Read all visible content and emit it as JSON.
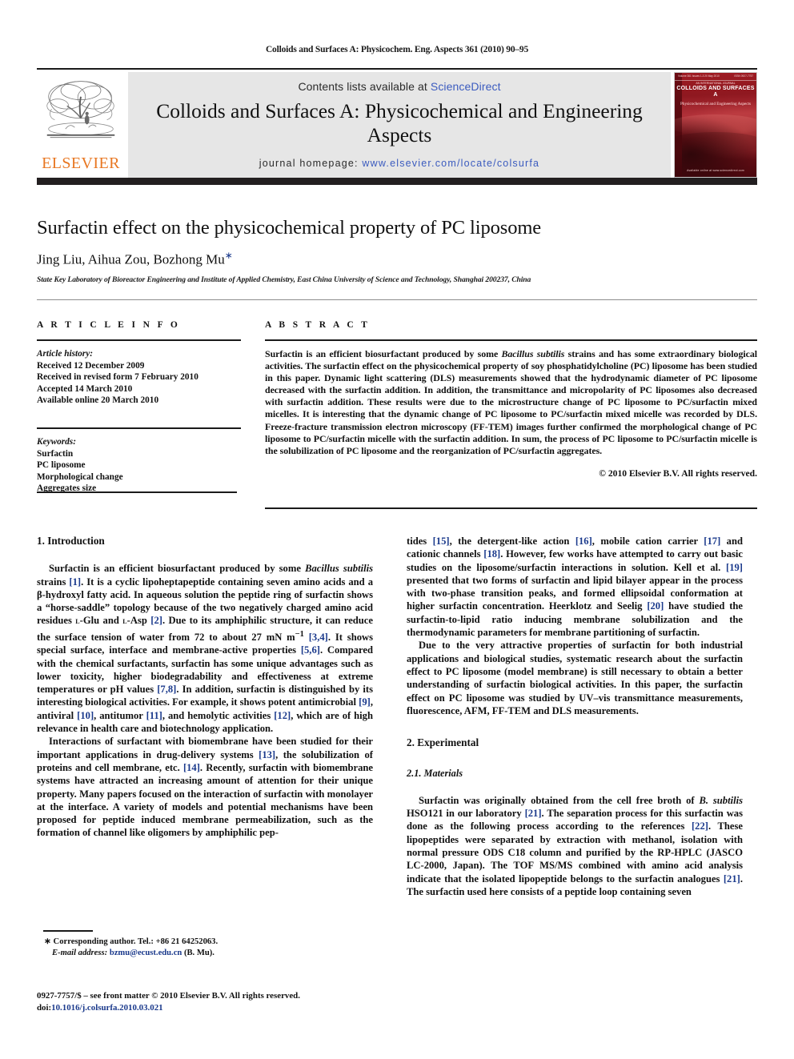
{
  "running_head": "Colloids and Surfaces A: Physicochem. Eng. Aspects 361 (2010) 90–95",
  "masthead": {
    "publisher_name": "ELSEVIER",
    "contents_prefix": "Contents lists available at ",
    "contents_link": "ScienceDirect",
    "journal_title": "Colloids and Surfaces A: Physicochemical and Engineering Aspects",
    "homepage_prefix": "journal homepage:",
    "homepage_url": "www.elsevier.com/locate/colsurfa",
    "cover": {
      "volume_line_left": "Volume 361 Issues 1-3 20 May 2010",
      "volume_line_right": "ISSN 0927-7757",
      "eyebrow": "AN INTERNATIONAL JOURNAL",
      "title": "COLLOIDS AND SURFACES A",
      "subtitle": "Physicochemical and Engineering Aspects",
      "footer": "Available online at www.sciencedirect.com"
    }
  },
  "article": {
    "title": "Surfactin effect on the physicochemical property of PC liposome",
    "authors": "Jing Liu, Aihua Zou, Bozhong Mu",
    "corresponding_marker": "∗",
    "affiliation": "State Key Laboratory of Bioreactor Engineering and Institute of Applied Chemistry, East China University of Science and Technology, Shanghai 200237, China"
  },
  "article_info": {
    "section_label": "A R T I C L E    I N F O",
    "history_label": "Article history:",
    "history": [
      "Received 12 December 2009",
      "Received in revised form 7 February 2010",
      "Accepted 14 March 2010",
      "Available online 20 March 2010"
    ],
    "keywords_label": "Keywords:",
    "keywords": [
      "Surfactin",
      "PC liposome",
      "Morphological change",
      "Aggregates size"
    ]
  },
  "abstract": {
    "section_label": "A B S T R A C T",
    "paragraph_1": "Surfactin is an efficient biosurfactant produced by some ",
    "italic_species": "Bacillus subtilis",
    "paragraph_2": " strains and has some extraordinary biological activities. The surfactin effect on the physicochemical property of soy phosphatidylcholine (PC) liposome has been studied in this paper. Dynamic light scattering (DLS) measurements showed that the hydrodynamic diameter of PC liposome decreased with the surfactin addition. In addition, the transmittance and micropolarity of PC liposomes also decreased with surfactin addition. These results were due to the microstructure change of PC liposome to PC/surfactin mixed micelles. It is interesting that the dynamic change of PC liposome to PC/surfactin mixed micelle was recorded by DLS. Freeze-fracture transmission electron microscopy (FF-TEM) images further confirmed the morphological change of PC liposome to PC/surfactin micelle with the surfactin addition. In sum, the process of PC liposome to PC/surfactin micelle is the solubilization of PC liposome and the reorganization of PC/surfactin aggregates.",
    "copyright": "© 2010 Elsevier B.V. All rights reserved."
  },
  "body": {
    "heading_introduction": "1.  Introduction",
    "heading_experimental": "2.  Experimental",
    "heading_materials": "2.1.  Materials",
    "left_p1_a": "Surfactin is an efficient biosurfactant produced by some ",
    "left_p1_italic1": "Bacillus subtilis",
    "left_p1_b": " strains ",
    "left_p1_ref1": "[1]",
    "left_p1_c": ". It is a cyclic lipoheptapeptide containing seven amino acids and a β-hydroxyl fatty acid. In aqueous solution the peptide ring of surfactin shows a “horse-saddle” topology because of the two negatively charged amino acid residues ",
    "left_p1_sc1": "l",
    "left_p1_d": "-Glu and ",
    "left_p1_sc2": "l",
    "left_p1_e": "-Asp ",
    "left_p1_ref2": "[2]",
    "left_p1_f": ". Due to its amphiphilic structure, it can reduce the surface tension of water from 72 to about 27 mN m",
    "left_p1_sup": "−1",
    "left_p1_g": " ",
    "left_p1_ref3": "[3,4]",
    "left_p1_h": ". It shows special surface, interface and membrane-active properties ",
    "left_p1_ref4": "[5,6]",
    "left_p1_i": ". Compared with the chemical surfactants, surfactin has some unique advantages such as lower toxicity, higher biodegradability and effectiveness at extreme temperatures or pH values ",
    "left_p1_ref5": "[7,8]",
    "left_p1_j": ". In addition, surfactin is distinguished by its interesting biological activities. For example, it shows potent antimicrobial ",
    "left_p1_ref6": "[9]",
    "left_p1_k": ", antiviral ",
    "left_p1_ref7": "[10]",
    "left_p1_l": ", antitumor ",
    "left_p1_ref8": "[11]",
    "left_p1_m": ", and hemolytic activities ",
    "left_p1_ref9": "[12]",
    "left_p1_n": ", which are of high relevance in health care and biotechnology application.",
    "left_p2_a": "Interactions of surfactant with biomembrane have been studied for their important applications in drug-delivery systems ",
    "left_p2_ref1": "[13]",
    "left_p2_b": ", the solubilization of proteins and cell membrane, etc. ",
    "left_p2_ref2": "[14]",
    "left_p2_c": ". Recently, surfactin with biomembrane systems have attracted an increasing amount of attention for their unique property. Many papers focused on the interaction of surfactin with monolayer at the interface. A variety of models and potential mechanisms have been proposed for peptide induced membrane permeabilization, such as the formation of channel like oligomers by amphiphilic pep-",
    "right_p1_a": "tides ",
    "right_p1_ref1": "[15]",
    "right_p1_b": ", the detergent-like action ",
    "right_p1_ref2": "[16]",
    "right_p1_c": ", mobile cation carrier ",
    "right_p1_ref3": "[17]",
    "right_p1_d": " and cationic channels ",
    "right_p1_ref4": "[18]",
    "right_p1_e": ". However, few works have attempted to carry out basic studies on the liposome/surfactin interactions in solution. Kell et al. ",
    "right_p1_ref5": "[19]",
    "right_p1_f": " presented that two forms of surfactin and lipid bilayer appear in the process with two-phase transition peaks, and formed ellipsoidal conformation at higher surfactin concentration. Heerklotz and Seelig ",
    "right_p1_ref6": "[20]",
    "right_p1_g": " have studied the surfactin-to-lipid ratio inducing membrane solubilization and the thermodynamic parameters for membrane partitioning of surfactin.",
    "right_p2": "Due to the very attractive properties of surfactin for both industrial applications and biological studies, systematic research about the surfactin effect to PC liposome (model membrane) is still necessary to obtain a better understanding of surfactin biological activities. In this paper, the surfactin effect on PC liposome was studied by UV–vis transmittance measurements, fluorescence, AFM, FF-TEM and DLS measurements.",
    "right_p3_a": "Surfactin was originally obtained from the cell free broth of ",
    "right_p3_italic1": "B. subtilis",
    "right_p3_b": " HSO121 in our laboratory ",
    "right_p3_ref1": "[21]",
    "right_p3_c": ". The separation process for this surfactin was done as the following process according to the references ",
    "right_p3_ref2": "[22]",
    "right_p3_d": ". These lipopeptides were separated by extraction with methanol, isolation with normal pressure ODS C18 column and purified by the RP-HPLC (JASCO LC-2000, Japan). The TOF MS/MS combined with amino acid analysis indicate that the isolated lipopeptide belongs to the surfactin analogues ",
    "right_p3_ref3": "[21]",
    "right_p3_e": ". The surfactin used here consists of a peptide loop containing seven"
  },
  "footer": {
    "corresponding_marker": "∗",
    "corresponding_text": " Corresponding author. Tel.: +86 21 64252063.",
    "email_label": "E-mail address:",
    "email": "bzmu@ecust.edu.cn",
    "email_suffix": " (B. Mu).",
    "issn_line": "0927-7757/$ – see front matter © 2010 Elsevier B.V. All rights reserved.",
    "doi_label": "doi:",
    "doi_value": "10.1016/j.colsurfa.2010.03.021"
  },
  "colors": {
    "link": "#1b3a8c",
    "sciencedirect": "#3b5bbf",
    "elsevier_orange": "#E87722",
    "banner_bg": "#e6e6e6",
    "dark_bar": "#231f20"
  }
}
